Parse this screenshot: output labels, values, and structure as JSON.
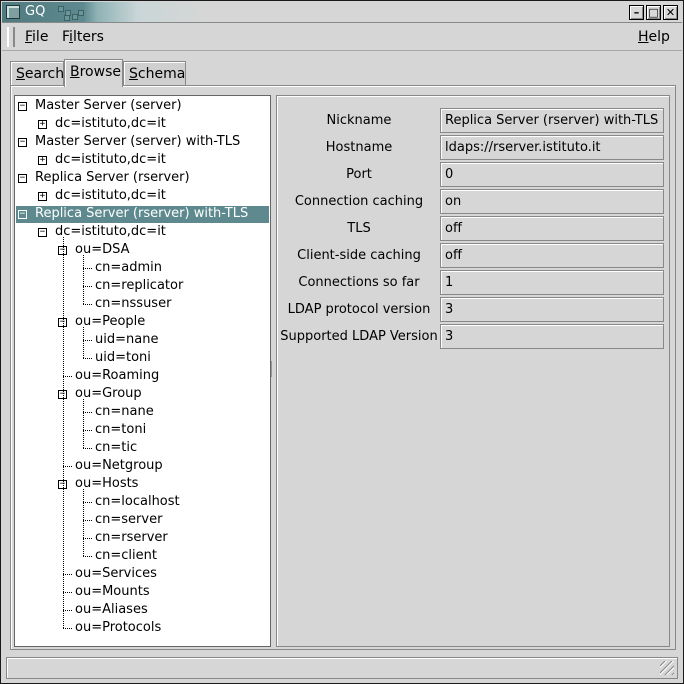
{
  "window": {
    "title": "GQ"
  },
  "menu": {
    "file": "File",
    "filters": "Filters",
    "help": "Help"
  },
  "tabs": [
    "Search",
    "Browse",
    "Schema"
  ],
  "tree": [
    {
      "label": "Master Server (server)",
      "depth": 0,
      "expander": "-"
    },
    {
      "label": "dc=istituto,dc=it",
      "depth": 1,
      "expander": "+"
    },
    {
      "label": "Master Server (server) with-TLS",
      "depth": 0,
      "expander": "-"
    },
    {
      "label": "dc=istituto,dc=it",
      "depth": 1,
      "expander": "+"
    },
    {
      "label": "Replica Server (rserver)",
      "depth": 0,
      "expander": "-"
    },
    {
      "label": "dc=istituto,dc=it",
      "depth": 1,
      "expander": "+"
    },
    {
      "label": "Replica Server (rserver) with-TLS",
      "depth": 0,
      "expander": "-",
      "selected": true
    },
    {
      "label": "dc=istituto,dc=it",
      "depth": 1,
      "expander": "-"
    },
    {
      "label": "ou=DSA",
      "depth": 2,
      "expander": "-"
    },
    {
      "label": "cn=admin",
      "depth": 3
    },
    {
      "label": "cn=replicator",
      "depth": 3
    },
    {
      "label": "cn=nssuser",
      "depth": 3
    },
    {
      "label": "ou=People",
      "depth": 2,
      "expander": "-"
    },
    {
      "label": "uid=nane",
      "depth": 3
    },
    {
      "label": "uid=toni",
      "depth": 3
    },
    {
      "label": "ou=Roaming",
      "depth": 2
    },
    {
      "label": "ou=Group",
      "depth": 2,
      "expander": "-"
    },
    {
      "label": "cn=nane",
      "depth": 3
    },
    {
      "label": "cn=toni",
      "depth": 3
    },
    {
      "label": "cn=tic",
      "depth": 3
    },
    {
      "label": "ou=Netgroup",
      "depth": 2
    },
    {
      "label": "ou=Hosts",
      "depth": 2,
      "expander": "-"
    },
    {
      "label": "cn=localhost",
      "depth": 3
    },
    {
      "label": "cn=server",
      "depth": 3
    },
    {
      "label": "cn=rserver",
      "depth": 3
    },
    {
      "label": "cn=client",
      "depth": 3
    },
    {
      "label": "ou=Services",
      "depth": 2
    },
    {
      "label": "ou=Mounts",
      "depth": 2
    },
    {
      "label": "ou=Aliases",
      "depth": 2
    },
    {
      "label": "ou=Protocols",
      "depth": 2
    }
  ],
  "properties": [
    {
      "label": "Nickname",
      "value": "Replica Server (rserver) with-TLS"
    },
    {
      "label": "Hostname",
      "value": "ldaps://rserver.istituto.it"
    },
    {
      "label": "Port",
      "value": "0"
    },
    {
      "label": "Connection caching",
      "value": "on"
    },
    {
      "label": "TLS",
      "value": "off"
    },
    {
      "label": "Client-side caching",
      "value": "off"
    },
    {
      "label": "Connections so far",
      "value": "1"
    },
    {
      "label": "LDAP protocol version",
      "value": "3"
    },
    {
      "label": "Supported LDAP Version",
      "value": "3"
    }
  ],
  "colors": {
    "selection": "#5e8a8f",
    "window_bg": "#d6d6d6"
  }
}
